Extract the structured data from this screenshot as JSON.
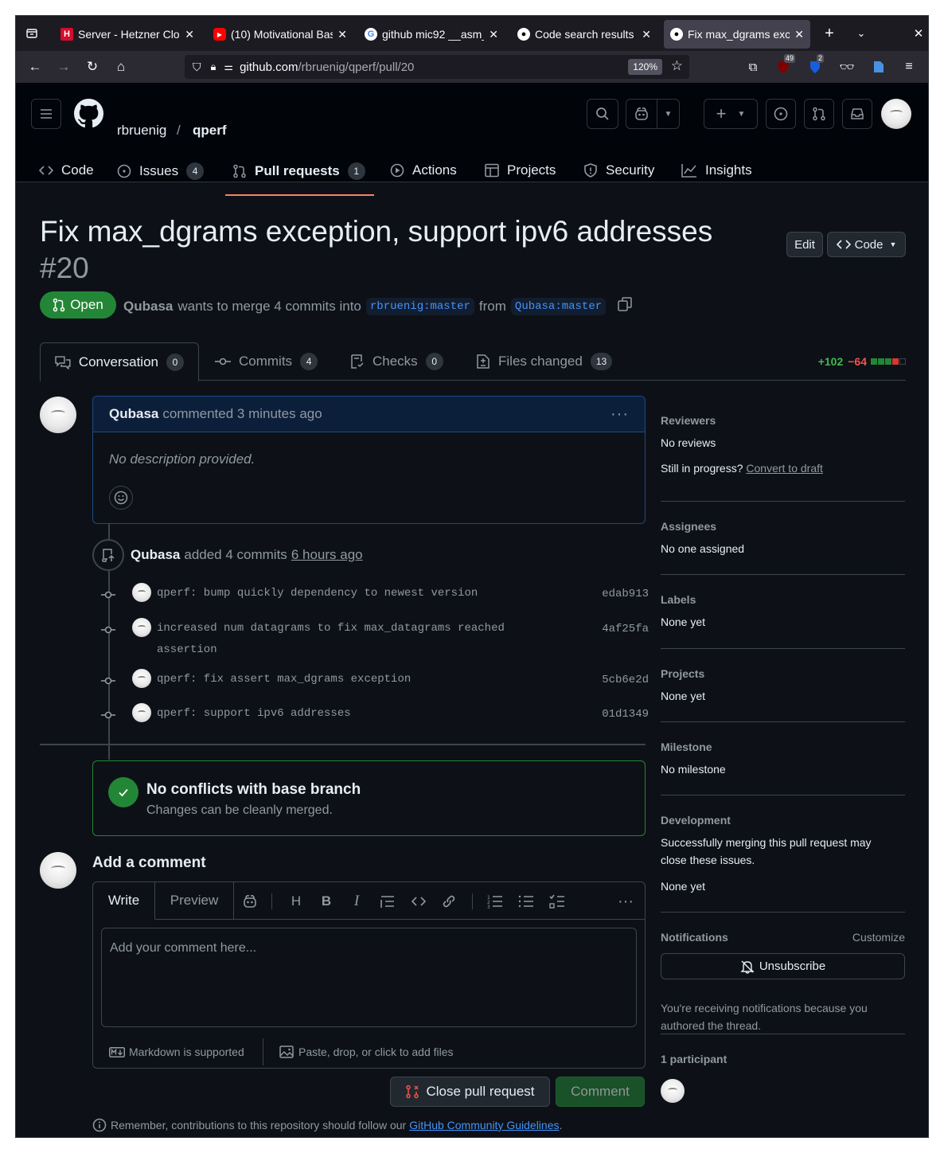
{
  "browser": {
    "tabs": [
      {
        "title": "Server - Hetzner Cloud",
        "icon": "hetzner-icon"
      },
      {
        "title": "(10) Motivational Bas",
        "icon": "youtube-icon"
      },
      {
        "title": "github mic92 __asm_",
        "icon": "google-icon"
      },
      {
        "title": "Code search results",
        "icon": "github-icon"
      },
      {
        "title": "Fix max_dgrams exce",
        "icon": "github-icon"
      }
    ],
    "url_host": "github.com",
    "url_path": "/rbruenig/qperf/pull/20",
    "zoom": "120%",
    "ext_badge_1": "49",
    "ext_badge_2": "2"
  },
  "header": {
    "owner": "rbruenig",
    "sep": "/",
    "repo": "qperf"
  },
  "repo_nav": [
    {
      "label": "Code",
      "count": ""
    },
    {
      "label": "Issues",
      "count": "4"
    },
    {
      "label": "Pull requests",
      "count": "1"
    },
    {
      "label": "Actions",
      "count": ""
    },
    {
      "label": "Projects",
      "count": ""
    },
    {
      "label": "Security",
      "count": ""
    },
    {
      "label": "Insights",
      "count": ""
    }
  ],
  "pr": {
    "title": "Fix max_dgrams exception, support ipv6 addresses",
    "number": "#20",
    "state": "Open",
    "author": "Qubasa",
    "meta_text": "wants to merge 4 commits into",
    "base": "rbruenig:master",
    "from": "from",
    "head": "Qubasa:master",
    "edit_label": "Edit",
    "code_label": "Code"
  },
  "tabs": [
    {
      "label": "Conversation",
      "count": "0"
    },
    {
      "label": "Commits",
      "count": "4"
    },
    {
      "label": "Checks",
      "count": "0"
    },
    {
      "label": "Files changed",
      "count": "13"
    }
  ],
  "diffstat": {
    "added": "+102",
    "removed": "−64"
  },
  "comment": {
    "author": "Qubasa",
    "action": "commented 3 minutes ago",
    "body": "No description provided."
  },
  "commits_event": {
    "author": "Qubasa",
    "text": "added 4 commits",
    "time": "6 hours ago"
  },
  "commits": [
    {
      "message": "qperf: bump quickly dependency to newest version",
      "sha": "edab913"
    },
    {
      "message": "increased num datagrams to fix max_datagrams reached assertion",
      "sha": "4af25fa"
    },
    {
      "message": "qperf: fix assert max_dgrams exception",
      "sha": "5cb6e2d"
    },
    {
      "message": "qperf: support ipv6 addresses",
      "sha": "01d1349"
    }
  ],
  "merge": {
    "title": "No conflicts with base branch",
    "subtitle": "Changes can be cleanly merged."
  },
  "add_comment": {
    "heading": "Add a comment",
    "write": "Write",
    "preview": "Preview",
    "placeholder": "Add your comment here...",
    "markdown": "Markdown is supported",
    "attach": "Paste, drop, or click to add files",
    "close_pr": "Close pull request",
    "comment": "Comment",
    "remember_text": "Remember, contributions to this repository should follow our",
    "remember_link": "GitHub Community Guidelines",
    "remember_end": "."
  },
  "sidebar": {
    "reviewers": {
      "heading": "Reviewers",
      "value": "No reviews",
      "draft_q": "Still in progress?",
      "draft_link": "Convert to draft"
    },
    "assignees": {
      "heading": "Assignees",
      "value": "No one assigned"
    },
    "labels": {
      "heading": "Labels",
      "value": "None yet"
    },
    "projects": {
      "heading": "Projects",
      "value": "None yet"
    },
    "milestone": {
      "heading": "Milestone",
      "value": "No milestone"
    },
    "development": {
      "heading": "Development",
      "text": "Successfully merging this pull request may close these issues.",
      "value": "None yet"
    },
    "notifications": {
      "heading": "Notifications",
      "customize": "Customize",
      "button": "Unsubscribe",
      "text": "You're receiving notifications because you authored the thread."
    },
    "participants": {
      "heading": "1 participant"
    }
  },
  "colors": {
    "accent": "#4493f8",
    "success": "#238636",
    "danger": "#f85149",
    "bg": "#0d1117"
  }
}
